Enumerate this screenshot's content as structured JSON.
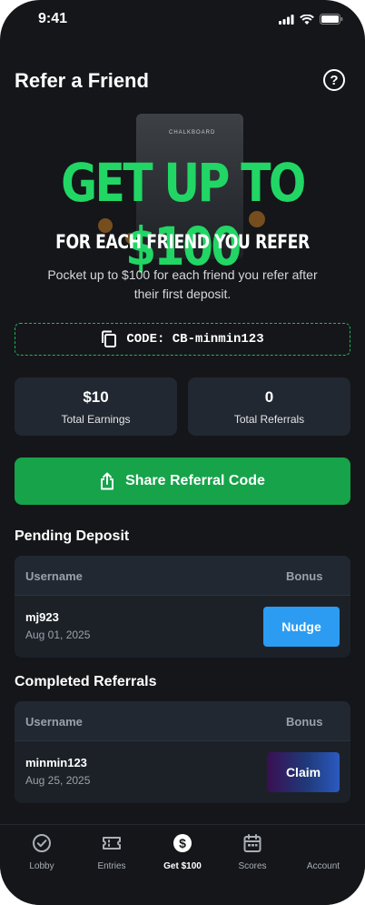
{
  "status_bar": {
    "time": "9:41"
  },
  "header": {
    "title": "Refer a Friend",
    "help_icon": "question-circle-icon"
  },
  "hero": {
    "headline": "GET UP TO $100",
    "subheadline": "FOR EACH FRIEND YOU REFER",
    "description": "Pocket up to $100 for each friend you refer after their first deposit.",
    "background_label": "CHALKBOARD"
  },
  "referral_code": {
    "label": "CODE: CB-minmin123",
    "icon": "copy-icon"
  },
  "stats": [
    {
      "value": "$10",
      "label": "Total Earnings"
    },
    {
      "value": "0",
      "label": "Total Referrals"
    }
  ],
  "share_button": {
    "label": "Share Referral Code",
    "icon": "share-icon"
  },
  "pending": {
    "title": "Pending Deposit",
    "columns": [
      "Username",
      "Bonus"
    ],
    "rows": [
      {
        "username": "mj923",
        "date": "Aug 01, 2025",
        "action": "Nudge"
      }
    ]
  },
  "completed": {
    "title": "Completed Referrals",
    "columns": [
      "Username",
      "Bonus"
    ],
    "rows": [
      {
        "username": "minmin123",
        "date": "Aug 25, 2025",
        "action": "Claim"
      }
    ]
  },
  "tabbar": {
    "tabs": [
      {
        "label": "Lobby",
        "icon": "check-circle-icon"
      },
      {
        "label": "Entries",
        "icon": "ticket-icon"
      },
      {
        "label": "Get $100",
        "icon": "dollar-circle-icon",
        "active": true
      },
      {
        "label": "Scores",
        "icon": "calendar-icon"
      },
      {
        "label": "Account",
        "icon": "account-icon"
      }
    ]
  },
  "colors": {
    "accent_green": "#21d664",
    "button_green": "#16a34a",
    "nudge_blue": "#2b9cf2",
    "background": "#141619"
  }
}
